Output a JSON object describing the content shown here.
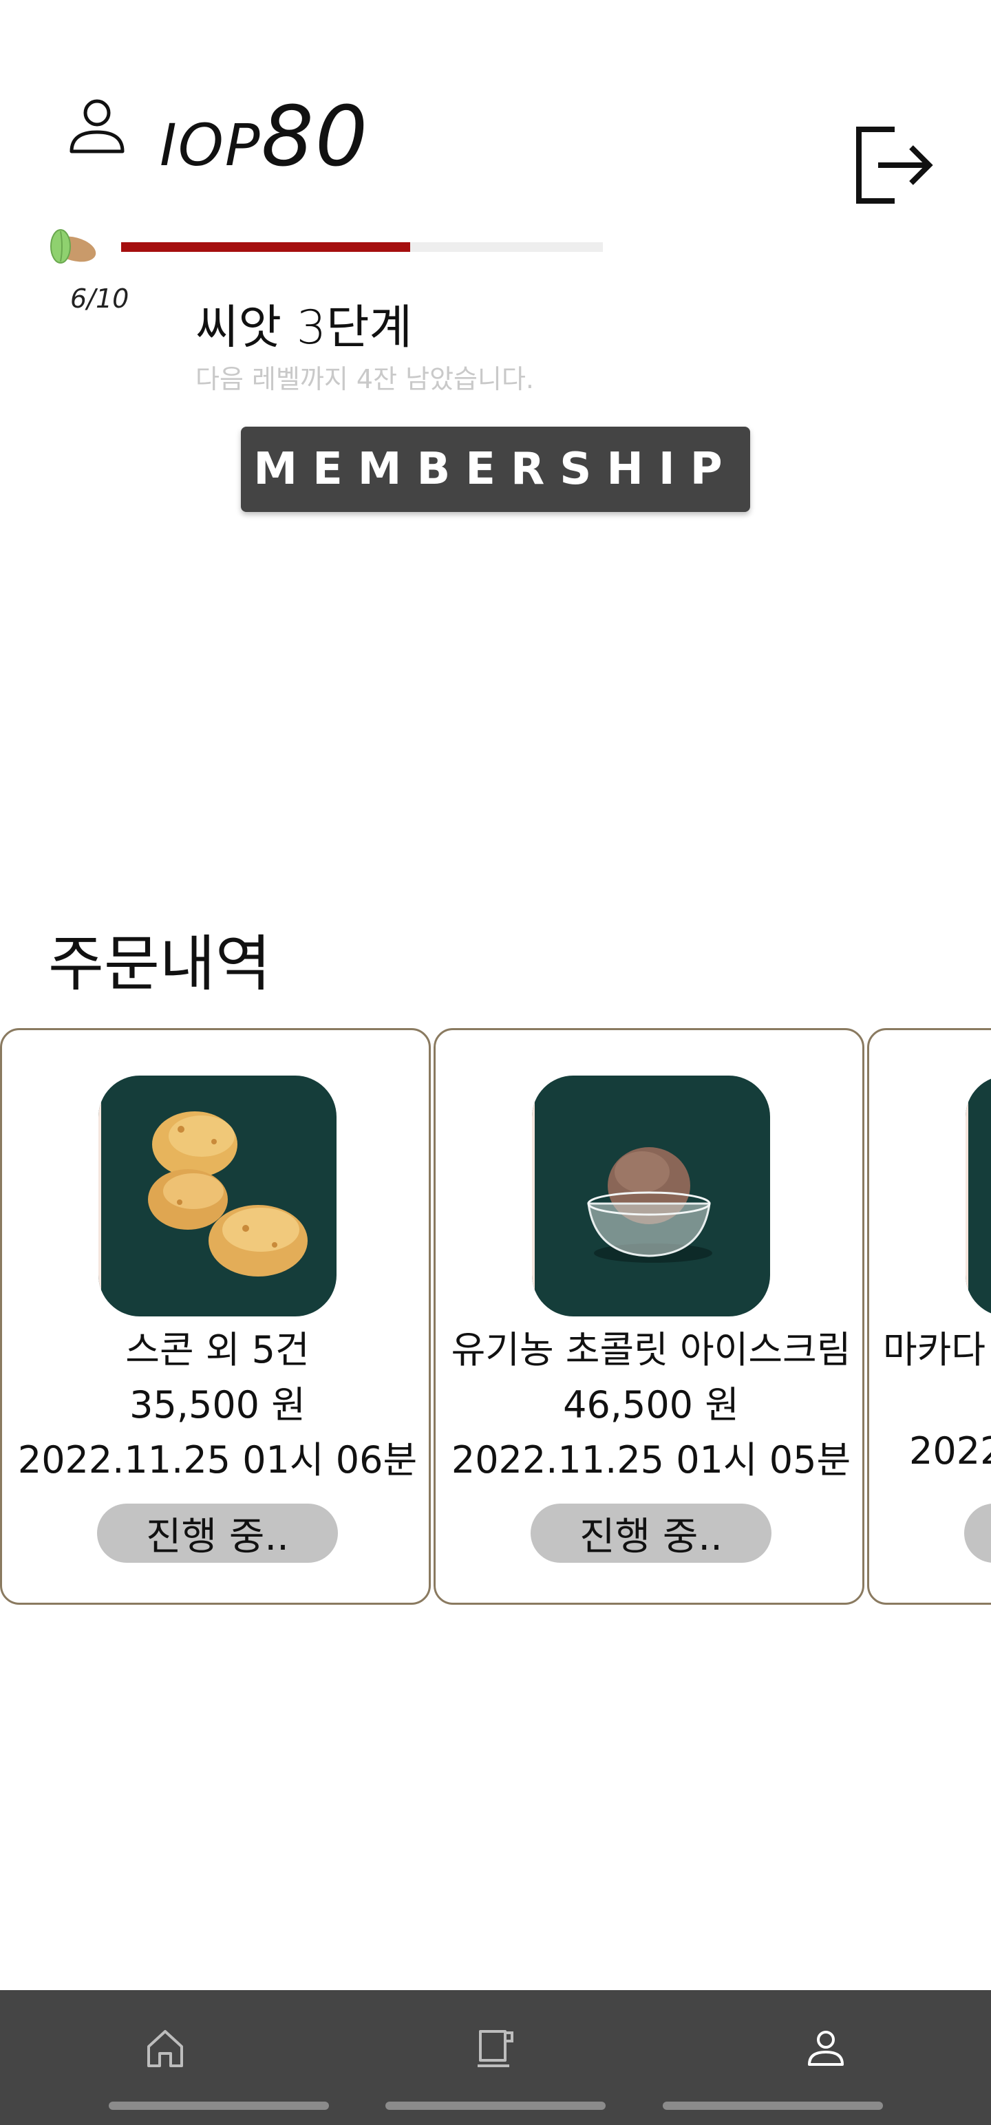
{
  "header": {
    "username_prefix": "IOP",
    "username_suffix": "80",
    "user_icon": "person-outline-icon",
    "logout_icon": "logout-icon"
  },
  "level": {
    "seed_icon": "almond-seed-icon",
    "progress_current": 6,
    "progress_total": 10,
    "progress_text": "6/10",
    "progress_color": "#a50f0f",
    "title": "씨앗 3단계",
    "subtitle": "다음 레벨까지 4잔 남았습니다."
  },
  "membership": {
    "button_label": "MEMBERSHIP"
  },
  "orders": {
    "section_title": "주문내역",
    "items": [
      {
        "name": "스콘 외 5건",
        "price": "35,500 원",
        "date": "2022.11.25 01시 06분",
        "status": "진행 중..",
        "image": "scone-image"
      },
      {
        "name": "유기농 초콜릿 아이스크림",
        "price": "46,500 원",
        "date": "2022.11.25 01시 05분",
        "status": "진행 중..",
        "image": "chocolate-ice-cream-image"
      },
      {
        "name": "마카다",
        "price": "",
        "date": "2022",
        "status": "",
        "image": "product-image"
      }
    ]
  },
  "bottom_nav": {
    "items": [
      {
        "icon": "home-icon"
      },
      {
        "icon": "coffee-cup-icon"
      },
      {
        "icon": "person-icon"
      }
    ]
  },
  "colors": {
    "card_border": "#8a7a60",
    "thumb_background": "#153d3a",
    "nav_background": "#454545",
    "button_background": "#444444",
    "status_pill": "#c3c3c3"
  }
}
